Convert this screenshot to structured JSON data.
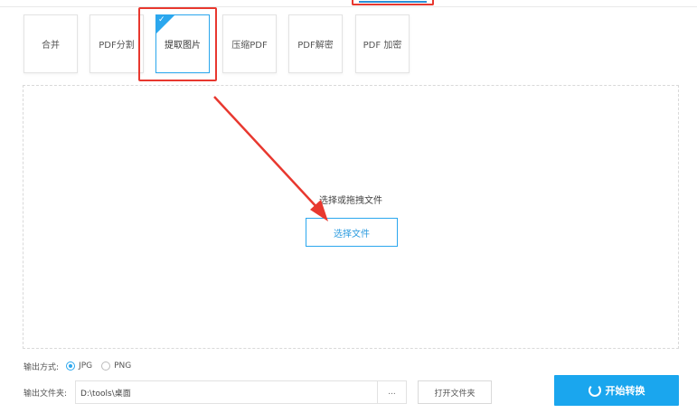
{
  "tools": [
    {
      "label": "合并"
    },
    {
      "label": "PDF分割"
    },
    {
      "label": "提取图片"
    },
    {
      "label": "压缩PDF"
    },
    {
      "label": "PDF解密"
    },
    {
      "label": "PDF 加密"
    }
  ],
  "active_tool": "提取图片",
  "dropzone": {
    "hint": "选择或拖拽文件",
    "choose_label": "选择文件"
  },
  "output_format": {
    "label": "输出方式:",
    "options": [
      "JPG",
      "PNG"
    ],
    "selected": "JPG"
  },
  "output_folder": {
    "label": "输出文件夹:",
    "value": "D:\\tools\\桌面",
    "browse_label": "...",
    "open_label": "打开文件夹"
  },
  "start_label": "开始转换",
  "colors": {
    "accent": "#1aa6ee",
    "highlight": "#e8382f"
  },
  "icons": [
    "check-icon",
    "refresh-icon",
    "red-arrow"
  ]
}
